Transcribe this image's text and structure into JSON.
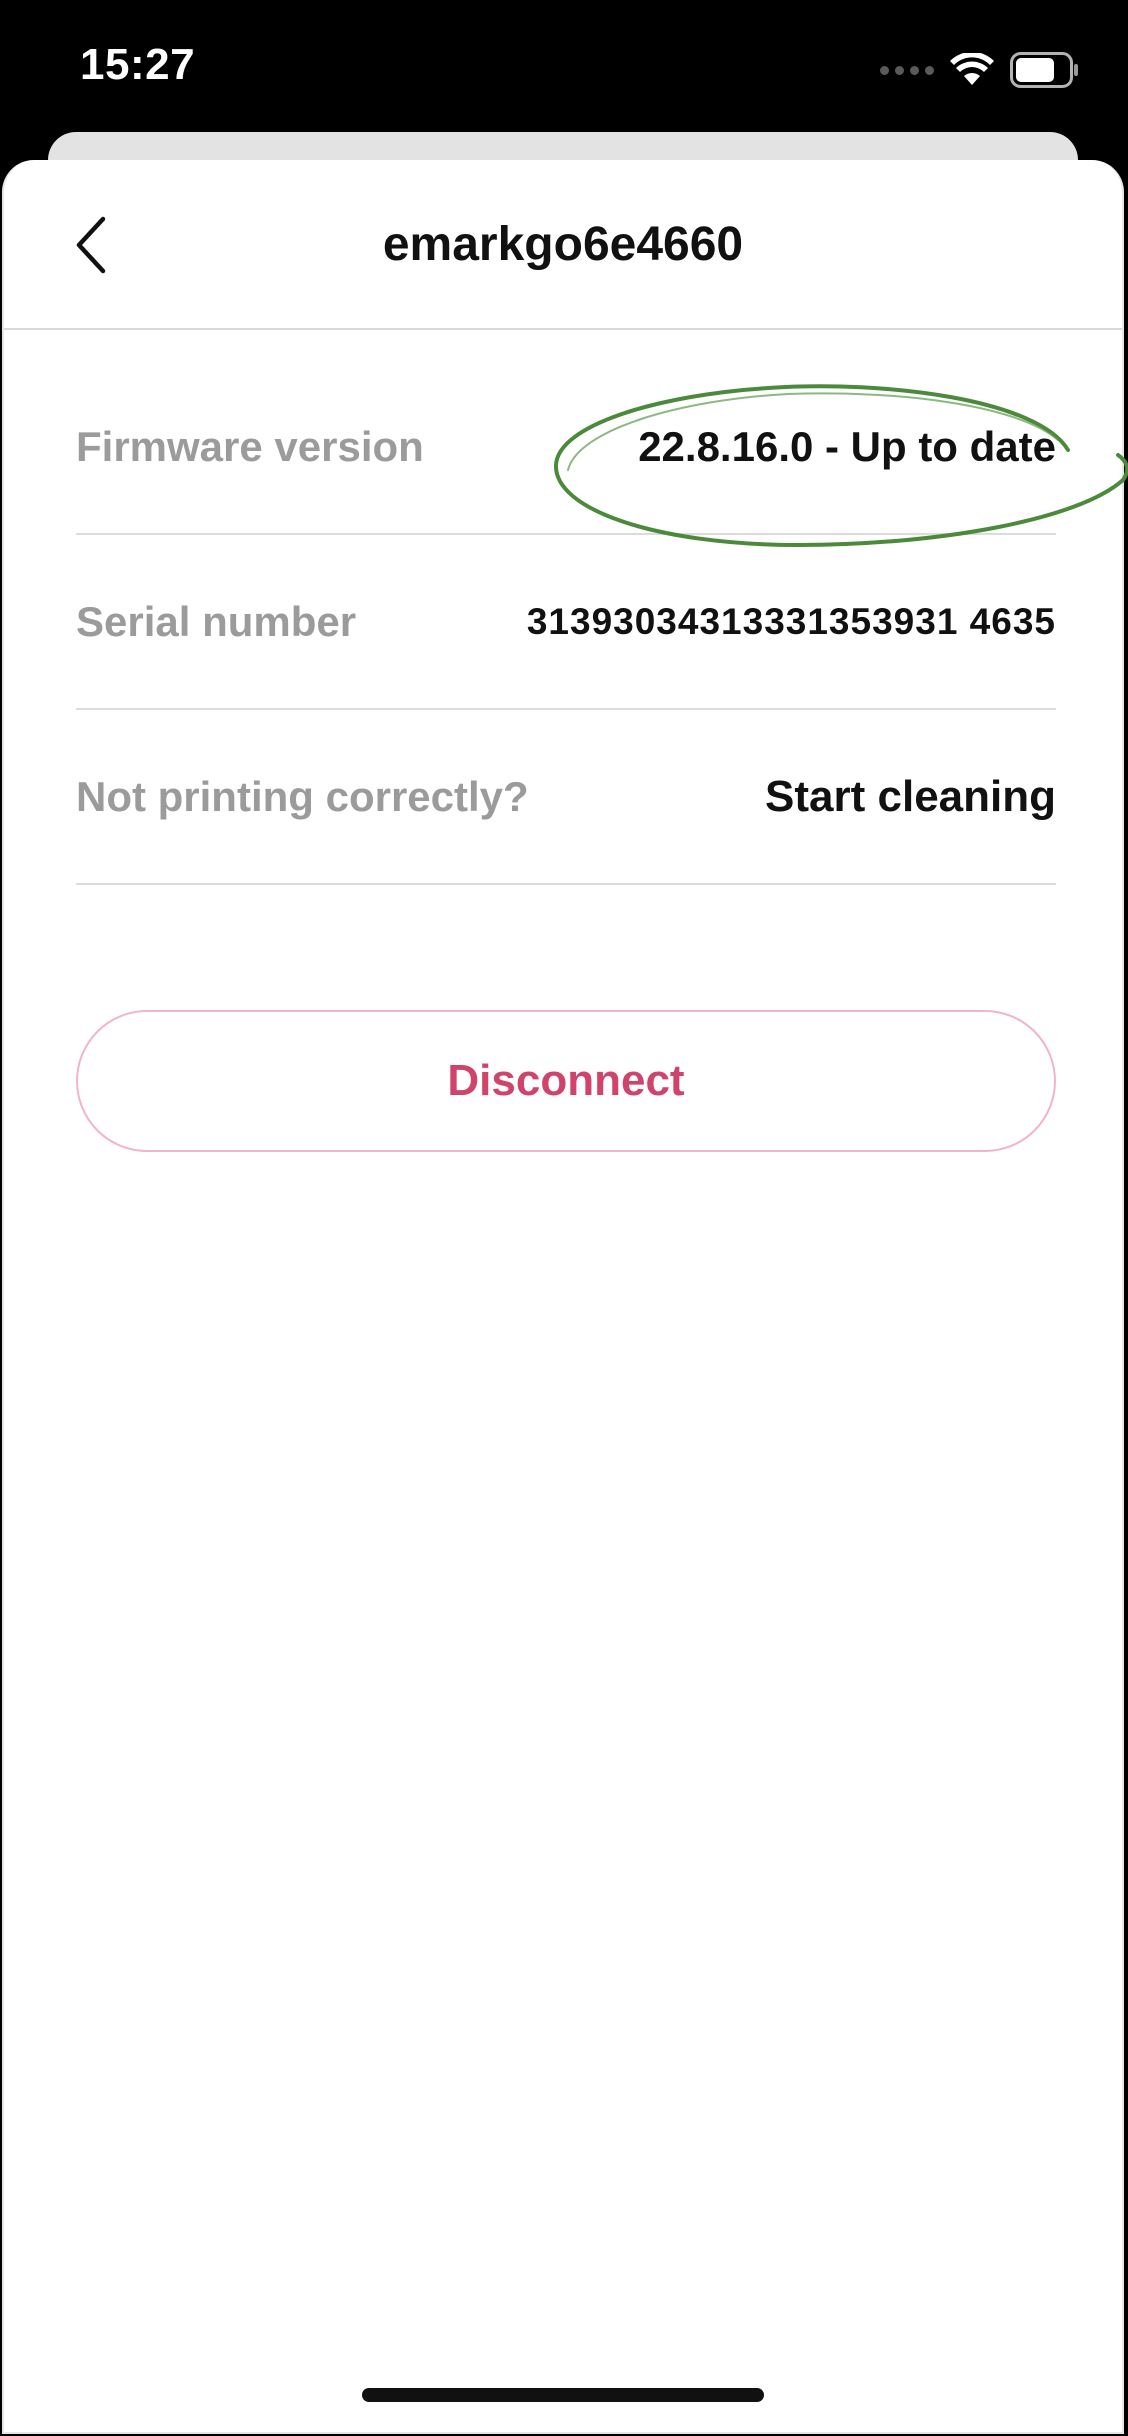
{
  "status_bar": {
    "time": "15:27",
    "icons": [
      "cellular-signal-icon",
      "wifi-icon",
      "battery-icon"
    ]
  },
  "header": {
    "title": "emarkgo6e4660",
    "back_icon": "chevron-left-icon"
  },
  "rows": [
    {
      "label": "Firmware version",
      "value": "22.8.16.0 - Up to date"
    },
    {
      "label": "Serial number",
      "value": "31393034313331353931 4635"
    },
    {
      "label": "Not printing correctly?",
      "action": "Start cleaning"
    }
  ],
  "disconnect_label": "Disconnect",
  "annotation": {
    "type": "hand-drawn ellipse",
    "color": "#4a8a3a",
    "target": "firmware version value"
  },
  "colors": {
    "accent": "#d0436a",
    "accent_border": "#f2b5c6",
    "label_gray": "#9b9b9b",
    "text": "#111111"
  }
}
